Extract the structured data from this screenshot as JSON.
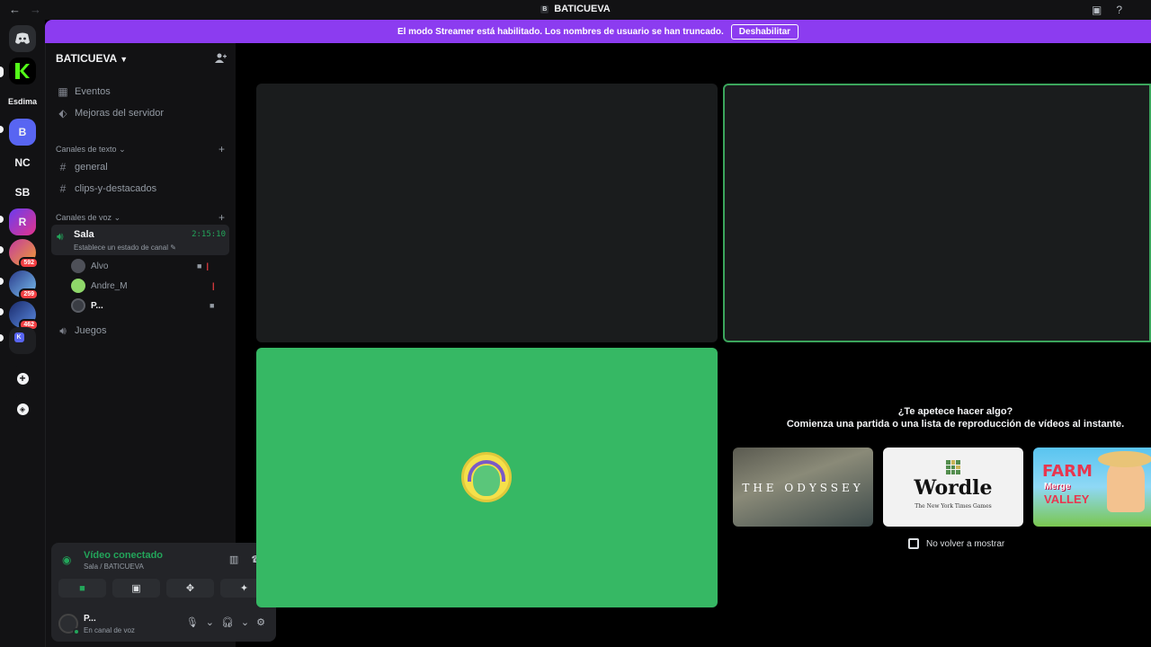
{
  "window": {
    "title": "BATICUEVA",
    "title_glyph": "B",
    "back_icon": "←",
    "forward_icon": "→"
  },
  "banner": {
    "text": "El modo Streamer está habilitado. Los nombres de usuario se han truncado.",
    "button": "Deshabilitar",
    "color": "#8c3cf0"
  },
  "rail": {
    "folder_label": "Esdima",
    "servers": [
      {
        "initials": "B"
      },
      {
        "initials": "NC"
      },
      {
        "initials": "SB"
      }
    ],
    "badges": [
      "592",
      "259",
      "462"
    ]
  },
  "guild": {
    "name": "BATICUEVA",
    "top_items": [
      {
        "label": "Eventos",
        "icon": "calendar-icon"
      },
      {
        "label": "Mejoras del servidor",
        "icon": "boost-icon"
      }
    ],
    "text_category": "Canales de texto",
    "text_channels": [
      "general",
      "clips-y-destacados"
    ],
    "voice_category": "Canales de voz",
    "active_voice": {
      "name": "Sala",
      "timer": "2:15:10",
      "status": "Establece un estado de canal"
    },
    "voice_users": [
      {
        "name": "Alvo",
        "video": true,
        "live": true
      },
      {
        "name": "Andre_M",
        "video": false,
        "live": true
      },
      {
        "name": "P...",
        "video": true,
        "live": false
      }
    ],
    "other_voice": "Juegos"
  },
  "voice_panel": {
    "title": "Vídeo conectado",
    "subtitle": "Sala / BATICUEVA",
    "user_name": "P...",
    "user_status": "En canal de voz",
    "accent": "#23a55a"
  },
  "activities": {
    "question": "¿Te apetece hacer algo?",
    "prompt": "Comienza una partida o una lista de reproducción de vídeos al instante.",
    "cards": [
      {
        "title": "THE ODYSSEY"
      },
      {
        "title": "Wordle",
        "byline": "The New York Times Games"
      },
      {
        "title": "FARM",
        "line2": "Merge",
        "line3": "VALLEY"
      }
    ],
    "dont_show": "No volver a mostrar"
  }
}
